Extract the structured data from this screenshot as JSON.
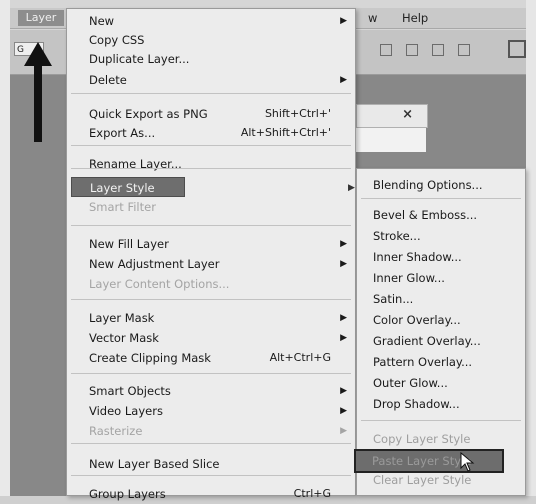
{
  "menubar": {
    "layer": "Layer",
    "view_fragment": "w",
    "help": "Help"
  },
  "optbar": {
    "field_text": "G"
  },
  "document": {
    "close_glyph": "×"
  },
  "layer_menu": {
    "items": [
      {
        "label": "New",
        "submenu": true
      },
      {
        "label": "Copy CSS"
      },
      {
        "label": "Duplicate Layer..."
      },
      {
        "label": "Delete",
        "submenu": true
      },
      {
        "label": "Quick Export as PNG",
        "shortcut": "Shift+Ctrl+'"
      },
      {
        "label": "Export As...",
        "shortcut": "Alt+Shift+Ctrl+'"
      },
      {
        "label": "Rename Layer..."
      },
      {
        "label": "Layer Style",
        "submenu": true,
        "highlighted": true
      },
      {
        "label": "Smart Filter",
        "disabled": true
      },
      {
        "label": "New Fill Layer",
        "submenu": true
      },
      {
        "label": "New Adjustment Layer",
        "submenu": true
      },
      {
        "label": "Layer Content Options...",
        "disabled": true
      },
      {
        "label": "Layer Mask",
        "submenu": true
      },
      {
        "label": "Vector Mask",
        "submenu": true
      },
      {
        "label": "Create Clipping Mask",
        "shortcut": "Alt+Ctrl+G"
      },
      {
        "label": "Smart Objects",
        "submenu": true
      },
      {
        "label": "Video Layers",
        "submenu": true
      },
      {
        "label": "Rasterize",
        "submenu": true,
        "disabled": true
      },
      {
        "label": "New Layer Based Slice"
      },
      {
        "label": "Group Layers",
        "shortcut": "Ctrl+G"
      }
    ]
  },
  "layer_style_menu": {
    "items": [
      {
        "label": "Blending Options..."
      },
      {
        "label": "Bevel & Emboss..."
      },
      {
        "label": "Stroke..."
      },
      {
        "label": "Inner Shadow..."
      },
      {
        "label": "Inner Glow..."
      },
      {
        "label": "Satin..."
      },
      {
        "label": "Color Overlay..."
      },
      {
        "label": "Gradient Overlay..."
      },
      {
        "label": "Pattern Overlay..."
      },
      {
        "label": "Outer Glow..."
      },
      {
        "label": "Drop Shadow..."
      },
      {
        "label": "Copy Layer Style",
        "disabled": true
      },
      {
        "label": "Paste Layer Style",
        "highlighted": true
      },
      {
        "label": "Clear Layer Style",
        "disabled": true
      }
    ]
  },
  "colors": {
    "highlight": "#6e6e6e",
    "menu_bg": "#ececec",
    "disabled": "#a4a4a4"
  }
}
